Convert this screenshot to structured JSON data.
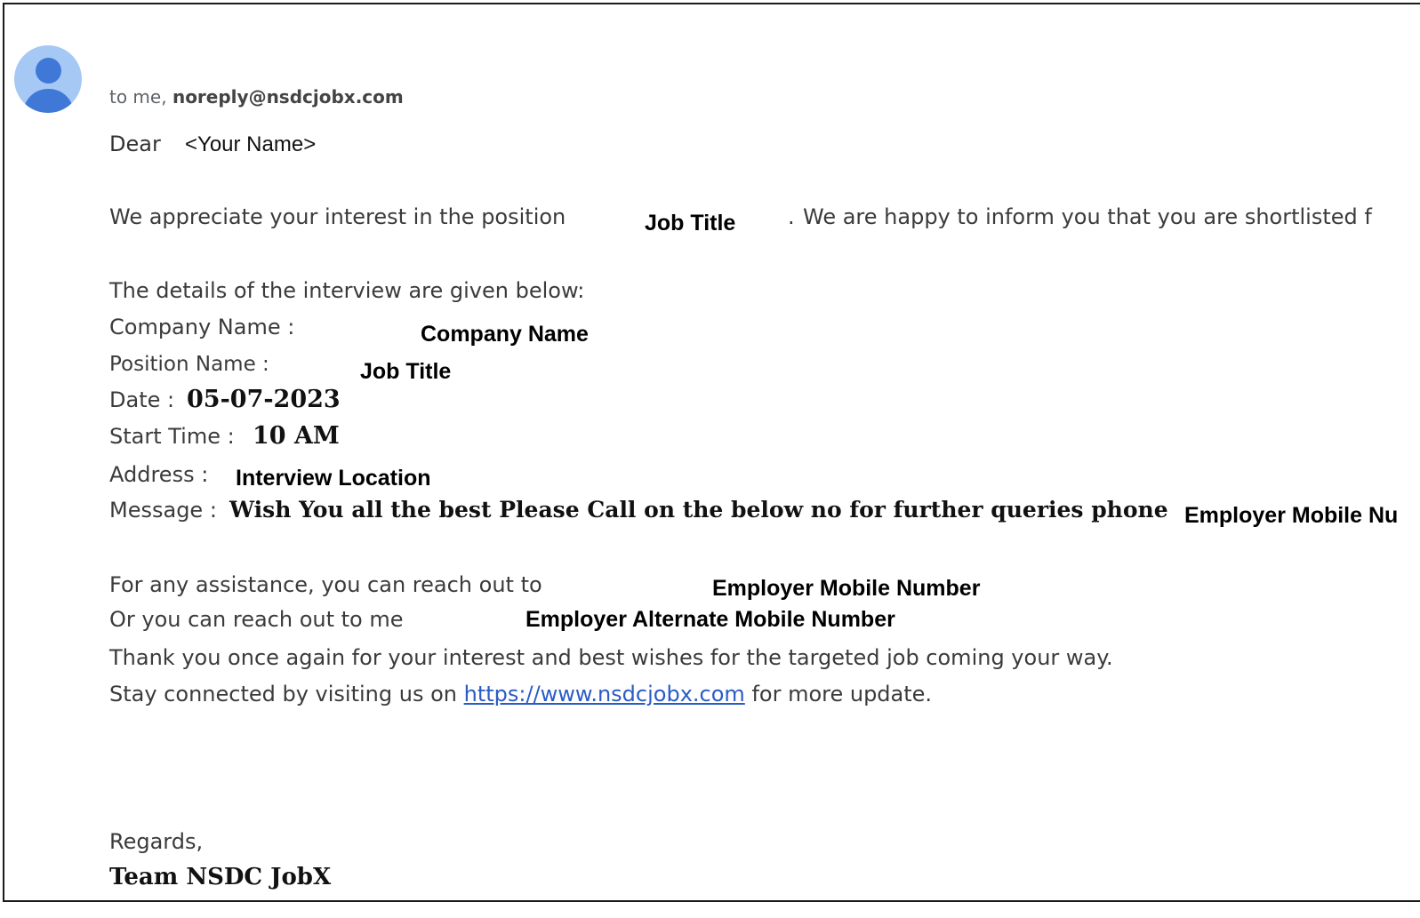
{
  "header": {
    "to_prefix": "to me,",
    "sender_email": "noreply@nsdcjobx.com"
  },
  "greeting": {
    "dear": "Dear",
    "name": "<Your Name>"
  },
  "intro": {
    "text": "We appreciate your interest in the position",
    "job_title": "Job Title",
    "dot": ".",
    "continuation": "We are happy to inform you that you are shortlisted f"
  },
  "details": {
    "heading": "The details of the interview are given below:",
    "company_label": "Company Name :",
    "company_value": "Company Name",
    "position_label": "Position Name :",
    "position_value": "Job Title",
    "date_label": "Date :",
    "date_value": "05-07-2023",
    "time_label": "Start Time :",
    "time_value": "10 AM",
    "address_label": "Address :",
    "address_value": "Interview Location",
    "message_label": "Message :",
    "message_value": "Wish You all the best Please Call on the below no for further queries phone",
    "message_phone": "Employer Mobile Nu"
  },
  "assistance": {
    "text": "For any assistance, you can reach out to",
    "mobile": "Employer Mobile Number",
    "alt_text": "Or you can reach out to me",
    "alt_mobile": "Employer Alternate Mobile Number"
  },
  "closing": {
    "thanks": "Thank you once again for your interest and best wishes for the targeted job coming your way.",
    "stay_prefix": "Stay connected by visiting us on",
    "link_text": "https://www.nsdcjobx.com",
    "stay_suffix": "for more update."
  },
  "signature": {
    "regards": "Regards,",
    "team": "Team NSDC JobX"
  },
  "colors": {
    "link": "#2a5cc6",
    "avatar_bg": "#a6c8f5",
    "avatar_fg": "#3f78d6"
  }
}
